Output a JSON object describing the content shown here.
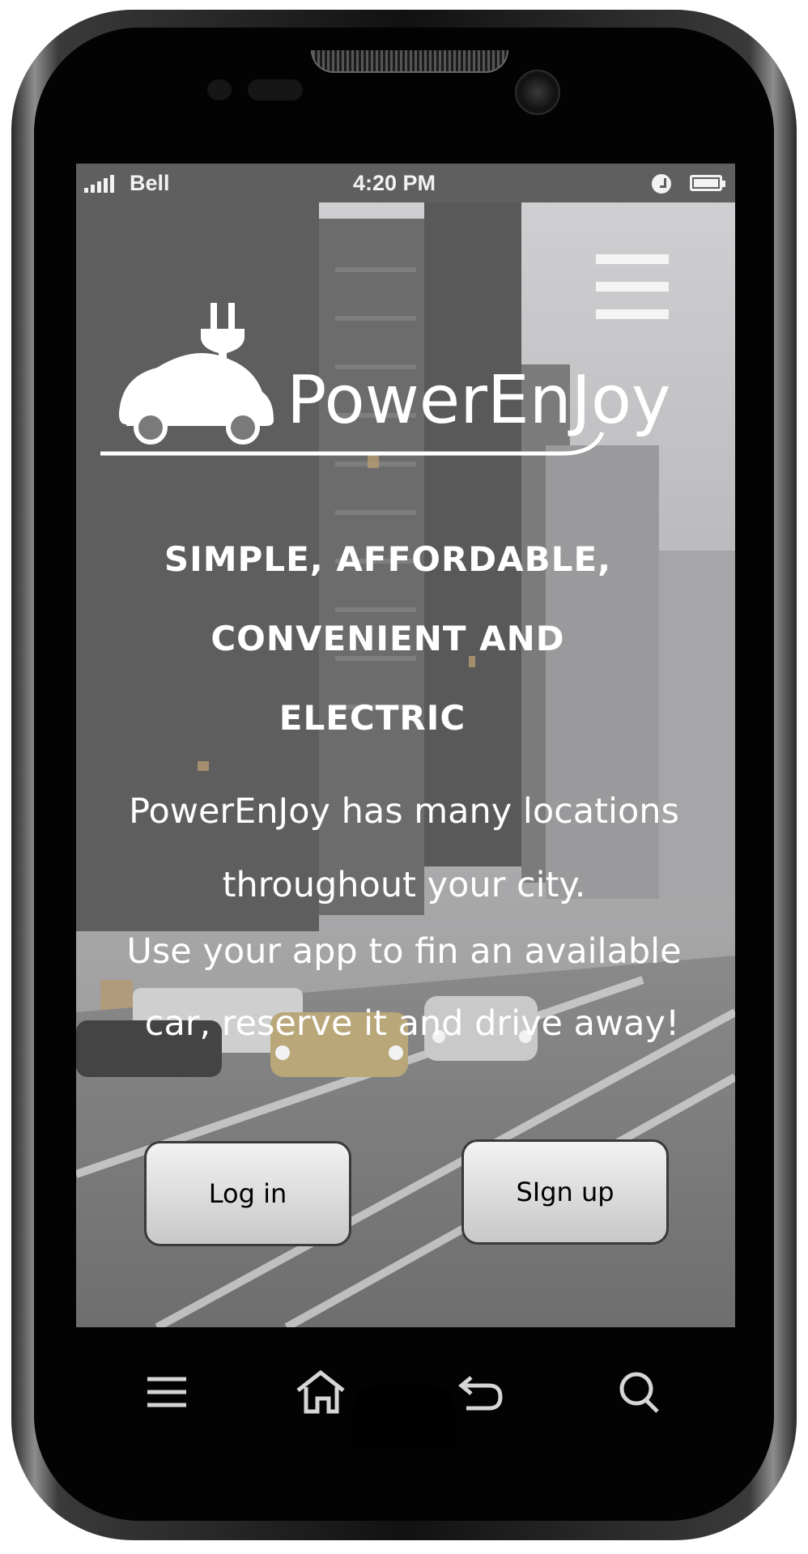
{
  "status_bar": {
    "carrier": "Bell",
    "time": "4:20 PM",
    "battery_icon": "battery-icon",
    "alarm_icon": "alarm-icon"
  },
  "header": {
    "menu_icon": "hamburger-menu-icon"
  },
  "logo": {
    "text": "PowerEnJoy",
    "icon": "electric-car-plug-icon"
  },
  "hero": {
    "headline_line1": "SIMPLE, AFFORDABLE,",
    "headline_line2": "CONVENIENT AND",
    "headline_line3": "ELECTRIC",
    "desc_line1": "PowerEnJoy has many locations",
    "desc_line2": "throughout your city.",
    "desc_line3": "Use your app to fin an available",
    "desc_line4": "car, reserve it and drive away!"
  },
  "actions": {
    "login_label": "Log in",
    "signup_label": "SIgn up"
  },
  "nav": {
    "icons": [
      "menu-icon",
      "home-icon",
      "back-icon",
      "search-icon"
    ]
  },
  "colors": {
    "overlay": "#7a7a7a",
    "text": "#ffffff",
    "button_bg": "#dcdcdc",
    "button_border": "#3a3a3a"
  }
}
